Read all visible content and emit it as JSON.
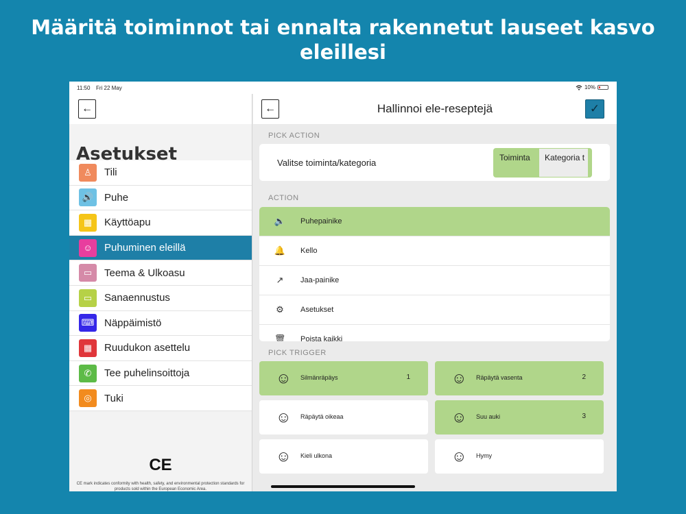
{
  "headline": {
    "line1": "Määritä toiminnot tai ennalta rakennetut lauseet kasvo",
    "line2": "eleillesi"
  },
  "status_bar": {
    "time": "11:50",
    "date": "Fri 22 May",
    "battery": "10%",
    "wifi_icon": "wifi-icon"
  },
  "sidebar": {
    "back_icon": "←",
    "title": "Asetukset",
    "items": [
      {
        "label": "Tili",
        "color": "#f08a5d",
        "icon": "♙",
        "icon_name": "person-icon"
      },
      {
        "label": "Puhe",
        "color": "#6ec1e4",
        "icon": "🔊",
        "icon_name": "speaker-icon"
      },
      {
        "label": "Käyttöapu",
        "color": "#f5c518",
        "icon": "▦",
        "icon_name": "keypad-icon"
      },
      {
        "label": "Puhuminen eleillä",
        "color": "#e83e9e",
        "icon": "☺",
        "icon_name": "face-icon",
        "active": true
      },
      {
        "label": "Teema & Ulkoasu",
        "color": "#d58aa8",
        "icon": "▭",
        "icon_name": "theme-icon"
      },
      {
        "label": "Sanaennustus",
        "color": "#b6d147",
        "icon": "▭",
        "icon_name": "prediction-icon"
      },
      {
        "label": "Näppäimistö",
        "color": "#3527e8",
        "icon": "⌨",
        "icon_name": "keyboard-icon"
      },
      {
        "label": "Ruudukon asettelu",
        "color": "#e0363a",
        "icon": "▦",
        "icon_name": "grid-icon"
      },
      {
        "label": "Tee puhelinsoittoja",
        "color": "#5dbb47",
        "icon": "✆",
        "icon_name": "phone-icon"
      },
      {
        "label": "Tuki",
        "color": "#f28b1e",
        "icon": "◎",
        "icon_name": "lifebuoy-icon"
      }
    ],
    "ce_mark": "CE",
    "ce_text": "CE mark indicates conformity with health, safety, and environmental protection standards for products sold within the European Economic Area."
  },
  "main": {
    "back_icon": "←",
    "title": "Hallinnoi ele-reseptejä",
    "confirm_icon": "✓",
    "pick_action_label": "PICK ACTION",
    "pick_prompt": "Valitse toiminta/kategoria",
    "segment_action": "Toiminta",
    "segment_category": "Kategoria t",
    "action_label": "ACTION",
    "actions": [
      {
        "label": "Puhepainike",
        "icon": "🔈",
        "icon_name": "speaker-icon",
        "selected": true
      },
      {
        "label": "Kello",
        "icon": "🔔",
        "icon_name": "bell-icon"
      },
      {
        "label": "Jaa-painike",
        "icon": "↗",
        "icon_name": "share-arrow-icon"
      },
      {
        "label": "Asetukset",
        "icon": "⚙",
        "icon_name": "gear-icon"
      },
      {
        "label": "Poista kaikki",
        "icon": "🗑",
        "icon_name": "trash-icon"
      }
    ],
    "pick_trigger_label": "PICK TRIGGER",
    "triggers": [
      {
        "label": "Silmänräpäys",
        "count": "1",
        "icon": "☺",
        "icon_name": "blink-face-icon",
        "selected": true
      },
      {
        "label": "Räpäytä vasenta",
        "count": "2",
        "icon": "☺",
        "icon_name": "wink-left-face-icon",
        "selected": true
      },
      {
        "label": "Räpäytä oikeaa",
        "count": "",
        "icon": "☺",
        "icon_name": "wink-right-face-icon",
        "selected": false
      },
      {
        "label": "Suu auki",
        "count": "3",
        "icon": "☺",
        "icon_name": "mouth-open-face-icon",
        "selected": true
      },
      {
        "label": "Kieli ulkona",
        "count": "",
        "icon": "☺",
        "icon_name": "tongue-out-face-icon",
        "selected": false
      },
      {
        "label": "Hymy",
        "count": "",
        "icon": "☺",
        "icon_name": "smile-face-icon",
        "selected": false
      }
    ]
  },
  "colors": {
    "background": "#1485ad",
    "active_blue": "#1e7fa7",
    "selected_green": "#b0d68a"
  }
}
